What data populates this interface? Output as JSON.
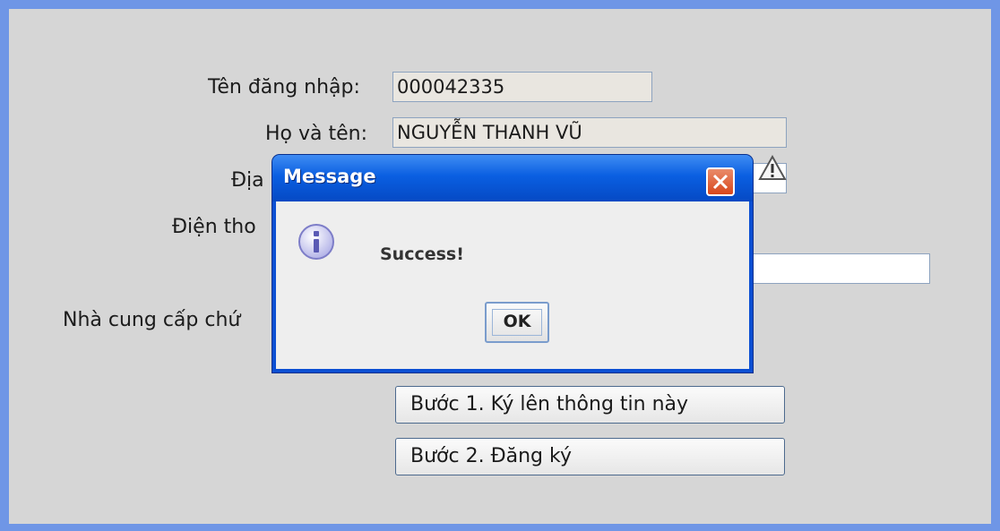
{
  "form": {
    "username_label": "Tên đăng nhập:",
    "username_value": "000042335",
    "fullname_label": "Họ và tên:",
    "fullname_value": "NGUYỄN THANH VŨ",
    "address_label": "Địa",
    "phone_label": "Điện tho",
    "provider_label": "Nhà cung cấp chứ",
    "step1_button": "Bước 1. Ký lên thông tin này",
    "step2_button": "Bước 2. Đăng ký"
  },
  "dialog": {
    "title": "Message",
    "message": "Success!",
    "ok_label": "OK"
  },
  "icons": {
    "warning": "warning-icon",
    "info": "info-icon",
    "close": "close-icon"
  },
  "colors": {
    "window_border": "#6f96e6",
    "panel_bg": "#d6d6d6",
    "titlebar": "#0a5fe1",
    "close_button": "#d8461b"
  }
}
